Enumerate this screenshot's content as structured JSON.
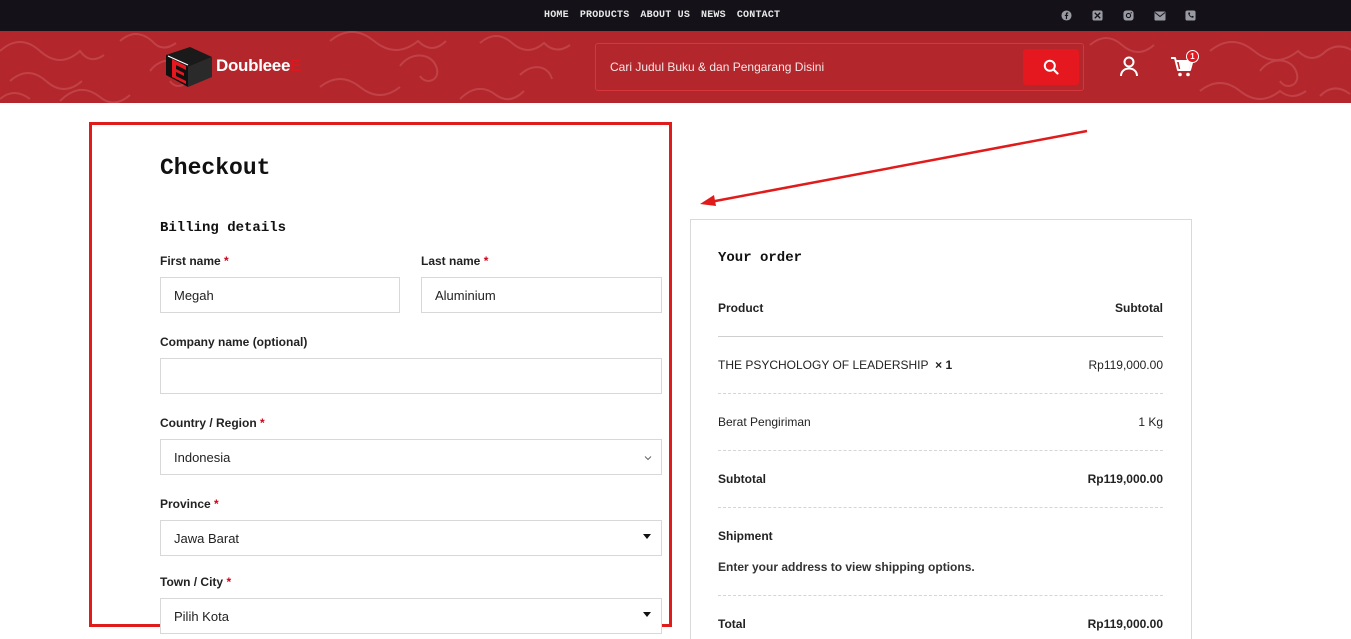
{
  "topnav": {
    "items": [
      "HOME",
      "PRODUCTS",
      "ABOUT US",
      "NEWS",
      "CONTACT"
    ],
    "social_icons": [
      "facebook-icon",
      "x-twitter-icon",
      "instagram-icon",
      "mail-icon",
      "phone-icon"
    ]
  },
  "header": {
    "logo_text": "Doubleee",
    "logo_accent": "E",
    "search_placeholder": "Cari Judul Buku & dan Pengarang Disini",
    "cart_count": "1",
    "brand_color": "#b3262b",
    "accent_color": "#e5171f"
  },
  "checkout": {
    "title": "Checkout",
    "billing_title": "Billing details",
    "first_name_label": "First name",
    "first_name_value": "Megah",
    "last_name_label": "Last name",
    "last_name_value": "Aluminium",
    "company_label": "Company name (optional)",
    "company_value": "",
    "country_label": "Country / Region",
    "country_value": "Indonesia",
    "province_label": "Province",
    "province_value": "Jawa Barat",
    "city_label": "Town / City",
    "city_value": "Pilih Kota",
    "required_mark": "*"
  },
  "order": {
    "title": "Your order",
    "col_product": "Product",
    "col_subtotal": "Subtotal",
    "item_name": "THE PSYCHOLOGY OF LEADERSHIP",
    "item_qty": "× 1",
    "item_price": "Rp119,000.00",
    "weight_label": "Berat Pengiriman",
    "weight_value": "1 Kg",
    "subtotal_label": "Subtotal",
    "subtotal_value": "Rp119,000.00",
    "shipment_label": "Shipment",
    "shipment_note": "Enter your address to view shipping options.",
    "total_label": "Total",
    "total_value": "Rp119,000.00"
  }
}
